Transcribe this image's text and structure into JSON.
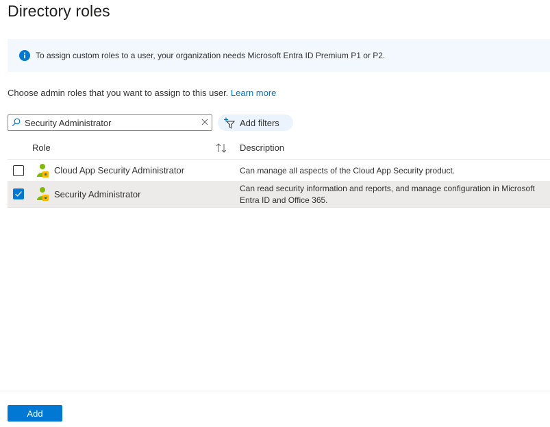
{
  "page": {
    "title": "Directory roles"
  },
  "info": {
    "message": "To assign custom roles to a user, your organization needs Microsoft Entra ID Premium P1 or P2."
  },
  "intro": {
    "text": "Choose admin roles that you want to assign to this user.",
    "link": "Learn more"
  },
  "search": {
    "value": "Security Administrator"
  },
  "filters": {
    "label": "Add filters"
  },
  "table": {
    "columns": {
      "role": "Role",
      "description": "Description"
    },
    "rows": [
      {
        "role": "Cloud App Security Administrator",
        "description": "Can manage all aspects of the Cloud App Security product.",
        "selected": false
      },
      {
        "role": "Security Administrator",
        "description": "Can read security information and reports, and manage configuration in Microsoft Entra ID and Office 365.",
        "selected": true
      }
    ]
  },
  "footer": {
    "add_label": "Add"
  },
  "colors": {
    "accent": "#0078d4",
    "info_bg": "#f2f8fd",
    "selected_row": "#edebe9"
  }
}
